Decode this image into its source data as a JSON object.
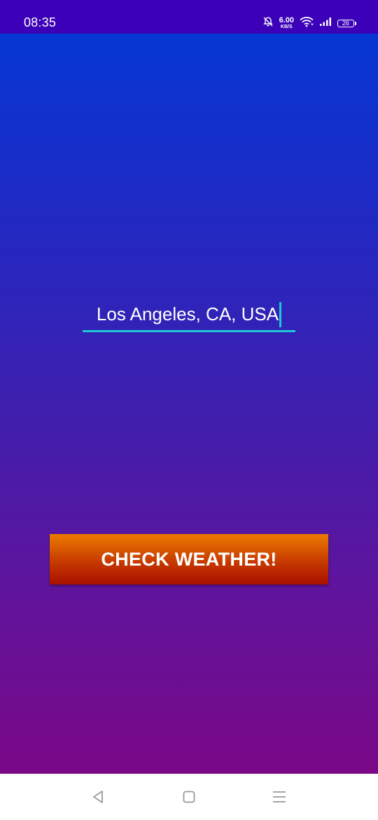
{
  "status_bar": {
    "time": "08:35",
    "net_speed_value": "6.00",
    "net_speed_unit": "KB/S",
    "battery": "26",
    "icons": [
      "mute-bell-icon",
      "wifi-icon",
      "cellular-signal-icon",
      "battery-icon"
    ]
  },
  "main": {
    "city_input_value": "Los Angeles, CA, USA",
    "check_button_label": "CHECK WEATHER!"
  },
  "nav_bar": {
    "icons": [
      "back-icon",
      "home-icon",
      "recents-icon"
    ]
  },
  "colors": {
    "status_bar_bg": "#3b00b8",
    "gradient_top": "#0637d4",
    "gradient_bottom": "#7a0887",
    "input_underline": "#1ec8d6",
    "button_top": "#ec7a00",
    "button_bottom": "#a80f00"
  }
}
